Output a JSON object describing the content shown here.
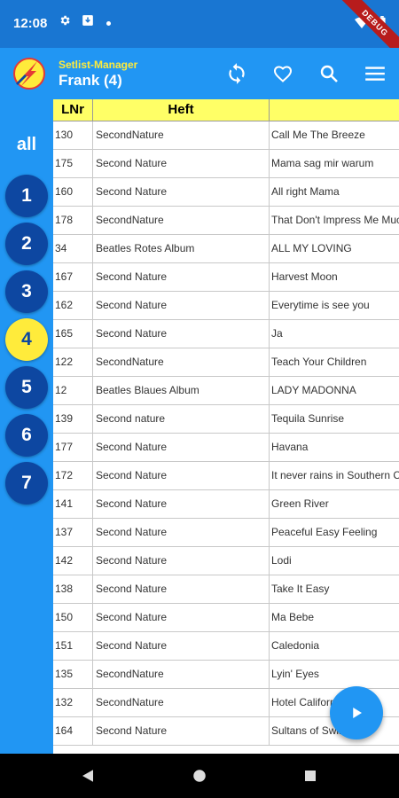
{
  "status_bar": {
    "time": "12:08",
    "debug_label": "DEBUG"
  },
  "app_bar": {
    "title": "Setlist-Manager",
    "subtitle": "Frank (4)"
  },
  "sidebar": {
    "all_label": "all",
    "items": [
      "1",
      "2",
      "3",
      "4",
      "5",
      "6",
      "7"
    ],
    "active": "4"
  },
  "table": {
    "headers": [
      "LNr",
      "Heft",
      ""
    ],
    "rows": [
      [
        "130",
        "SecondNature",
        "Call Me The Breeze"
      ],
      [
        "175",
        "Second Nature",
        "Mama sag mir warum"
      ],
      [
        "160",
        "Second Nature",
        "All right Mama"
      ],
      [
        "178",
        "SecondNature",
        "That Don't Impress Me Much"
      ],
      [
        "34",
        "Beatles Rotes Album",
        "ALL MY LOVING"
      ],
      [
        "167",
        "Second Nature",
        "Harvest Moon"
      ],
      [
        "162",
        "Second Nature",
        "Everytime is see you"
      ],
      [
        "165",
        "Second Nature",
        "Ja"
      ],
      [
        "122",
        "SecondNature",
        "Teach Your Children"
      ],
      [
        "12",
        "Beatles Blaues Album",
        "LADY MADONNA"
      ],
      [
        "139",
        "Second nature",
        "Tequila Sunrise"
      ],
      [
        "177",
        "Second Nature",
        "Havana"
      ],
      [
        "172",
        "Second Nature",
        "It never rains in Southern California"
      ],
      [
        "141",
        "Second Nature",
        "Green River"
      ],
      [
        "137",
        "Second Nature",
        "Peaceful Easy Feeling"
      ],
      [
        "142",
        "Second Nature",
        "Lodi"
      ],
      [
        "138",
        "Second Nature",
        "Take It Easy"
      ],
      [
        "150",
        "Second Nature",
        "Ma Bebe"
      ],
      [
        "151",
        "Second Nature",
        "Caledonia"
      ],
      [
        "135",
        "SecondNature",
        "Lyin' Eyes"
      ],
      [
        "132",
        "SecondNature",
        "Hotel California"
      ],
      [
        "164",
        "Second Nature",
        "Sultans of Swing"
      ]
    ]
  },
  "colors": {
    "appbar": "#2196f3",
    "statusbar": "#1976d2",
    "circle": "#0d47a1",
    "active_circle": "#ffeb3b",
    "header_bg": "#ffff66"
  },
  "icons": {
    "sync": "sync-icon",
    "favorite": "heart-icon",
    "search": "search-icon",
    "menu": "menu-icon",
    "play": "play-icon"
  }
}
